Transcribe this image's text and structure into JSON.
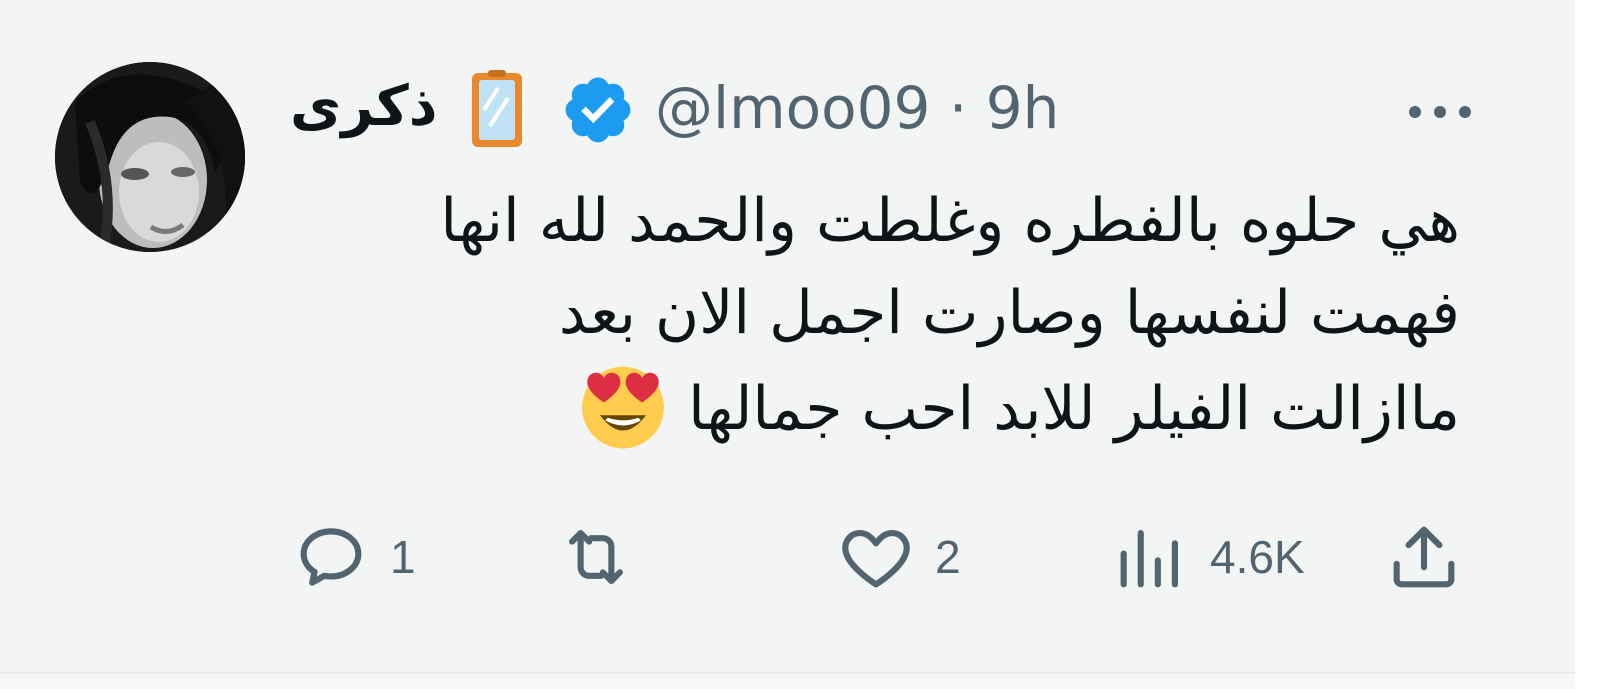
{
  "tweet": {
    "display_name": "ذكرى",
    "handle": "@lmoo09",
    "separator": "·",
    "time": "9h",
    "body_lines": [
      "هي حلوه بالفطره وغلطت والحمد لله انها",
      "فهمت لنفسها وصارت اجمل الان بعد",
      "ماازالت الفيلر للابد احب جمالها"
    ],
    "emoji": "smiling-face-with-heart-eyes",
    "icons": {
      "badge": "mirror-icon",
      "verified": "verified-badge-icon",
      "more": "more-icon"
    },
    "colors": {
      "verified": "#1d9bf0",
      "secondary_text": "#536471",
      "text": "#0f1419"
    }
  },
  "actions": {
    "reply_count": "1",
    "retweet_count": "",
    "like_count": "2",
    "views_count": "4.6K"
  }
}
